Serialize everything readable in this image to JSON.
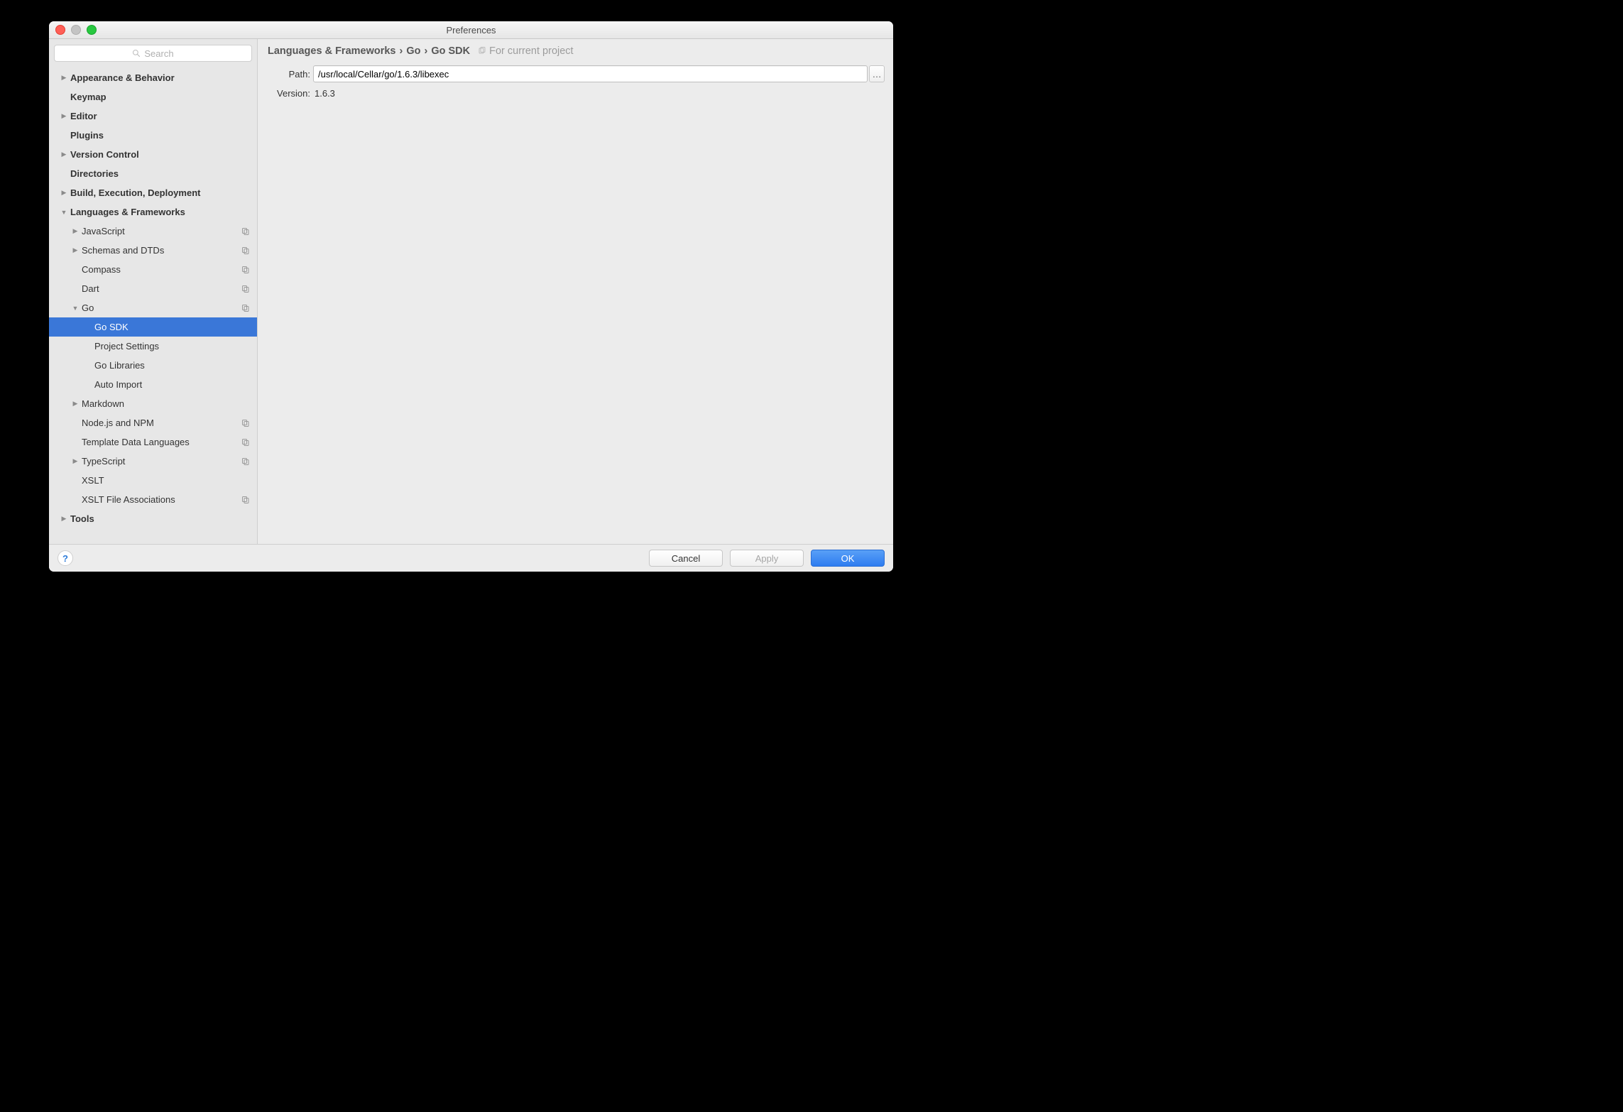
{
  "window": {
    "title": "Preferences"
  },
  "search": {
    "placeholder": "Search"
  },
  "sidebar": {
    "items": [
      {
        "label": "Appearance & Behavior",
        "depth": 0,
        "bold": true,
        "arrow": "right",
        "proj": false,
        "selected": false
      },
      {
        "label": "Keymap",
        "depth": 0,
        "bold": true,
        "arrow": "",
        "proj": false,
        "selected": false
      },
      {
        "label": "Editor",
        "depth": 0,
        "bold": true,
        "arrow": "right",
        "proj": false,
        "selected": false
      },
      {
        "label": "Plugins",
        "depth": 0,
        "bold": true,
        "arrow": "",
        "proj": false,
        "selected": false
      },
      {
        "label": "Version Control",
        "depth": 0,
        "bold": true,
        "arrow": "right",
        "proj": false,
        "selected": false
      },
      {
        "label": "Directories",
        "depth": 0,
        "bold": true,
        "arrow": "",
        "proj": false,
        "selected": false
      },
      {
        "label": "Build, Execution, Deployment",
        "depth": 0,
        "bold": true,
        "arrow": "right",
        "proj": false,
        "selected": false
      },
      {
        "label": "Languages & Frameworks",
        "depth": 0,
        "bold": true,
        "arrow": "down",
        "proj": false,
        "selected": false
      },
      {
        "label": "JavaScript",
        "depth": 1,
        "bold": false,
        "arrow": "right",
        "proj": true,
        "selected": false
      },
      {
        "label": "Schemas and DTDs",
        "depth": 1,
        "bold": false,
        "arrow": "right",
        "proj": true,
        "selected": false
      },
      {
        "label": "Compass",
        "depth": 1,
        "bold": false,
        "arrow": "",
        "proj": true,
        "selected": false
      },
      {
        "label": "Dart",
        "depth": 1,
        "bold": false,
        "arrow": "",
        "proj": true,
        "selected": false
      },
      {
        "label": "Go",
        "depth": 1,
        "bold": false,
        "arrow": "down",
        "proj": true,
        "selected": false
      },
      {
        "label": "Go SDK",
        "depth": 2,
        "bold": false,
        "arrow": "",
        "proj": false,
        "selected": true
      },
      {
        "label": "Project Settings",
        "depth": 2,
        "bold": false,
        "arrow": "",
        "proj": false,
        "selected": false
      },
      {
        "label": "Go Libraries",
        "depth": 2,
        "bold": false,
        "arrow": "",
        "proj": false,
        "selected": false
      },
      {
        "label": "Auto Import",
        "depth": 2,
        "bold": false,
        "arrow": "",
        "proj": false,
        "selected": false
      },
      {
        "label": "Markdown",
        "depth": 1,
        "bold": false,
        "arrow": "right",
        "proj": false,
        "selected": false
      },
      {
        "label": "Node.js and NPM",
        "depth": 1,
        "bold": false,
        "arrow": "",
        "proj": true,
        "selected": false
      },
      {
        "label": "Template Data Languages",
        "depth": 1,
        "bold": false,
        "arrow": "",
        "proj": true,
        "selected": false
      },
      {
        "label": "TypeScript",
        "depth": 1,
        "bold": false,
        "arrow": "right",
        "proj": true,
        "selected": false
      },
      {
        "label": "XSLT",
        "depth": 1,
        "bold": false,
        "arrow": "",
        "proj": false,
        "selected": false
      },
      {
        "label": "XSLT File Associations",
        "depth": 1,
        "bold": false,
        "arrow": "",
        "proj": true,
        "selected": false
      },
      {
        "label": "Tools",
        "depth": 0,
        "bold": true,
        "arrow": "right",
        "proj": false,
        "selected": false
      }
    ]
  },
  "breadcrumb": {
    "parts": [
      "Languages & Frameworks",
      "Go",
      "Go SDK"
    ],
    "sep": "›",
    "hint": "For current project"
  },
  "main": {
    "path_label": "Path:",
    "path_value": "/usr/local/Cellar/go/1.6.3/libexec",
    "browse_label": "…",
    "version_label": "Version:",
    "version_value": "1.6.3"
  },
  "footer": {
    "help": "?",
    "cancel": "Cancel",
    "apply": "Apply",
    "ok": "OK"
  }
}
